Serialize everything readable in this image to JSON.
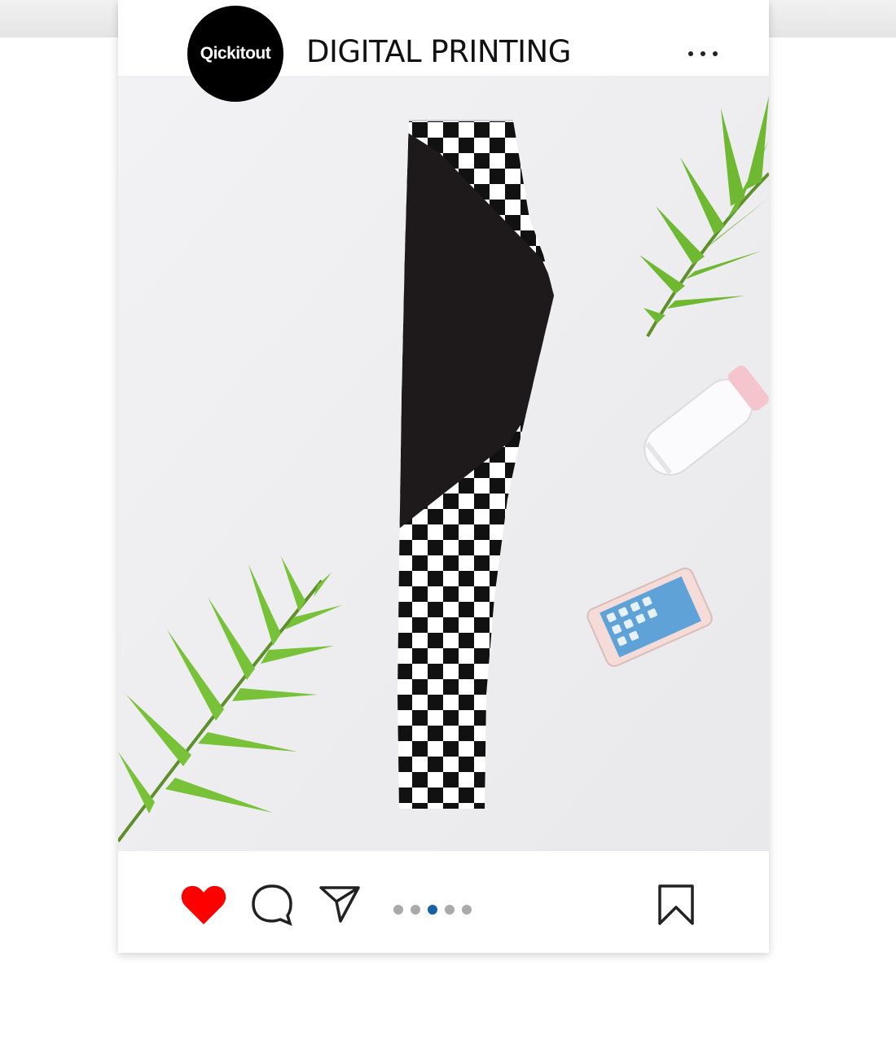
{
  "post": {
    "avatar_text": "Qickitout",
    "account_name": "DIGITAL PRINTING",
    "image_subject": "leggings-checkerboard-product",
    "carousel": {
      "total": 5,
      "active_index": 2
    },
    "like_state": "liked"
  },
  "colors": {
    "like": "#ff0000",
    "dot_active": "#1a5fa8",
    "dot_inactive": "#aaaaaa",
    "avatar_bg": "#000000"
  },
  "icons": [
    "more-options-icon",
    "heart-icon",
    "comment-icon",
    "send-icon",
    "bookmark-icon"
  ]
}
